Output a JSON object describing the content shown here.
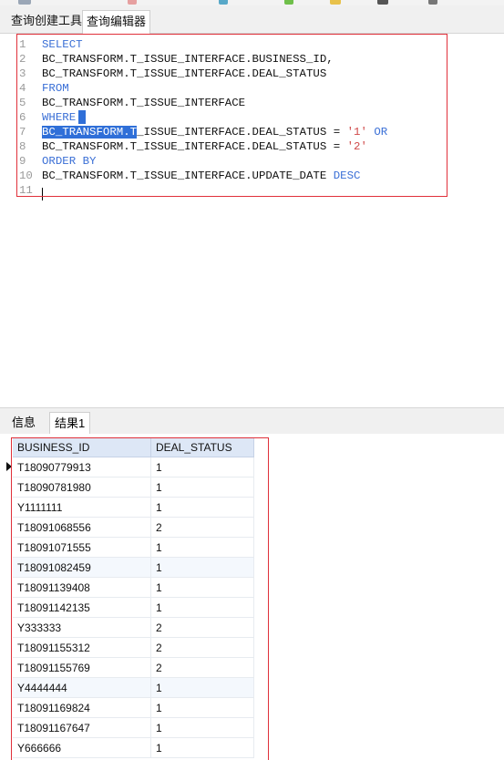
{
  "tabs": {
    "query_builder": "查询创建工具",
    "query_editor": "查询编辑器"
  },
  "editor": {
    "lines": [
      {
        "num": "1",
        "parts": [
          {
            "t": "SELECT",
            "c": "kw"
          }
        ]
      },
      {
        "num": "2",
        "parts": [
          {
            "t": "BC_TRANSFORM.T_ISSUE_INTERFACE.BUSINESS_ID,",
            "c": "pl"
          }
        ]
      },
      {
        "num": "3",
        "parts": [
          {
            "t": "BC_TRANSFORM.T_ISSUE_INTERFACE.DEAL_STATUS",
            "c": "pl"
          }
        ]
      },
      {
        "num": "4",
        "parts": [
          {
            "t": "FROM",
            "c": "kw"
          }
        ]
      },
      {
        "num": "5",
        "parts": [
          {
            "t": "BC_TRANSFORM.T_ISSUE_INTERFACE",
            "c": "pl"
          }
        ]
      },
      {
        "num": "6",
        "parts": [
          {
            "t": "WHERE",
            "c": "kw"
          }
        ]
      },
      {
        "num": "7",
        "parts": [
          {
            "t": "BC_TRANSFORM.T",
            "c": "sel"
          },
          {
            "t": "_ISSUE_INTERFACE.DEAL_STATUS = ",
            "c": "pl"
          },
          {
            "t": "'1'",
            "c": "str"
          },
          {
            "t": " OR",
            "c": "kw"
          }
        ]
      },
      {
        "num": "8",
        "parts": [
          {
            "t": "BC_TRANSFORM.T_ISSUE_INTERFACE.DEAL_STATUS = ",
            "c": "pl"
          },
          {
            "t": "'2'",
            "c": "str"
          }
        ]
      },
      {
        "num": "9",
        "parts": [
          {
            "t": "ORDER BY",
            "c": "kw"
          }
        ]
      },
      {
        "num": "10",
        "parts": [
          {
            "t": "BC_TRANSFORM.T_ISSUE_INTERFACE.UPDATE_DATE ",
            "c": "pl"
          },
          {
            "t": "DESC",
            "c": "kw"
          }
        ]
      },
      {
        "num": "11",
        "parts": []
      }
    ]
  },
  "result_tabs": {
    "info": "信息",
    "result1": "结果1"
  },
  "grid": {
    "columns": [
      "BUSINESS_ID",
      "DEAL_STATUS"
    ],
    "rows": [
      [
        "T18090779913",
        "1"
      ],
      [
        "T18090781980",
        "1"
      ],
      [
        "Y1111111",
        "1"
      ],
      [
        "T18091068556",
        "2"
      ],
      [
        "T18091071555",
        "1"
      ],
      [
        "T18091082459",
        "1"
      ],
      [
        "T18091139408",
        "1"
      ],
      [
        "T18091142135",
        "1"
      ],
      [
        "Y333333",
        "2"
      ],
      [
        "T18091155312",
        "2"
      ],
      [
        "T18091155769",
        "2"
      ],
      [
        "Y4444444",
        "1"
      ],
      [
        "T18091169824",
        "1"
      ],
      [
        "T18091167647",
        "1"
      ],
      [
        "Y666666",
        "1"
      ]
    ]
  },
  "colors": {
    "keyword": "#3a6fd6",
    "string": "#d04a4a",
    "selection": "#2f6fd8",
    "highlight_box": "#e0303a",
    "header_bg": "#dde7f6"
  }
}
